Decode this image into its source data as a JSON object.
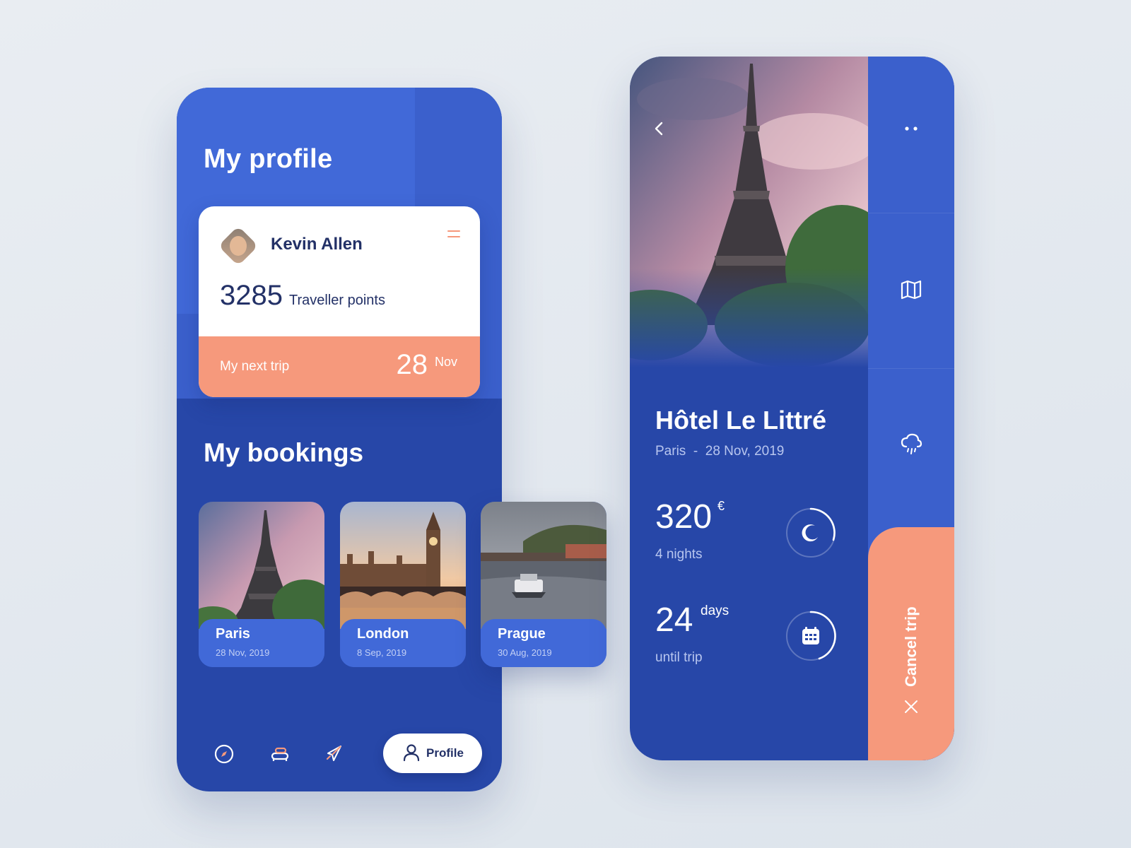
{
  "profile_screen": {
    "title": "My profile",
    "user": {
      "name": "Kevin Allen",
      "points": "3285",
      "points_label": "Traveller points"
    },
    "next_trip": {
      "label": "My next trip",
      "day": "28",
      "month": "Nov"
    },
    "bookings_title": "My bookings",
    "bookings": [
      {
        "city": "Paris",
        "date": "28 Nov, 2019"
      },
      {
        "city": "London",
        "date": "8 Sep, 2019"
      },
      {
        "city": "Prague",
        "date": "30 Aug, 2019"
      }
    ],
    "nav": {
      "profile_label": "Profile",
      "items": [
        "compass-icon",
        "bed-icon",
        "plane-icon",
        "user-icon"
      ]
    }
  },
  "hotel_screen": {
    "name": "Hôtel Le Littré",
    "city": "Paris",
    "separator": "-",
    "date": "28 Nov, 2019",
    "price": "320",
    "currency": "€",
    "nights": "4 nights",
    "days": "24",
    "days_unit": "days",
    "until": "until trip",
    "cancel_label": "Cancel trip",
    "side_icons": [
      "more-dots-icon",
      "map-icon",
      "weather-rain-icon"
    ]
  },
  "colors": {
    "primary_dark": "#2747a8",
    "primary": "#3b60cc",
    "primary_light": "#4169d8",
    "accent": "#f6997c",
    "text_dark": "#233167"
  }
}
